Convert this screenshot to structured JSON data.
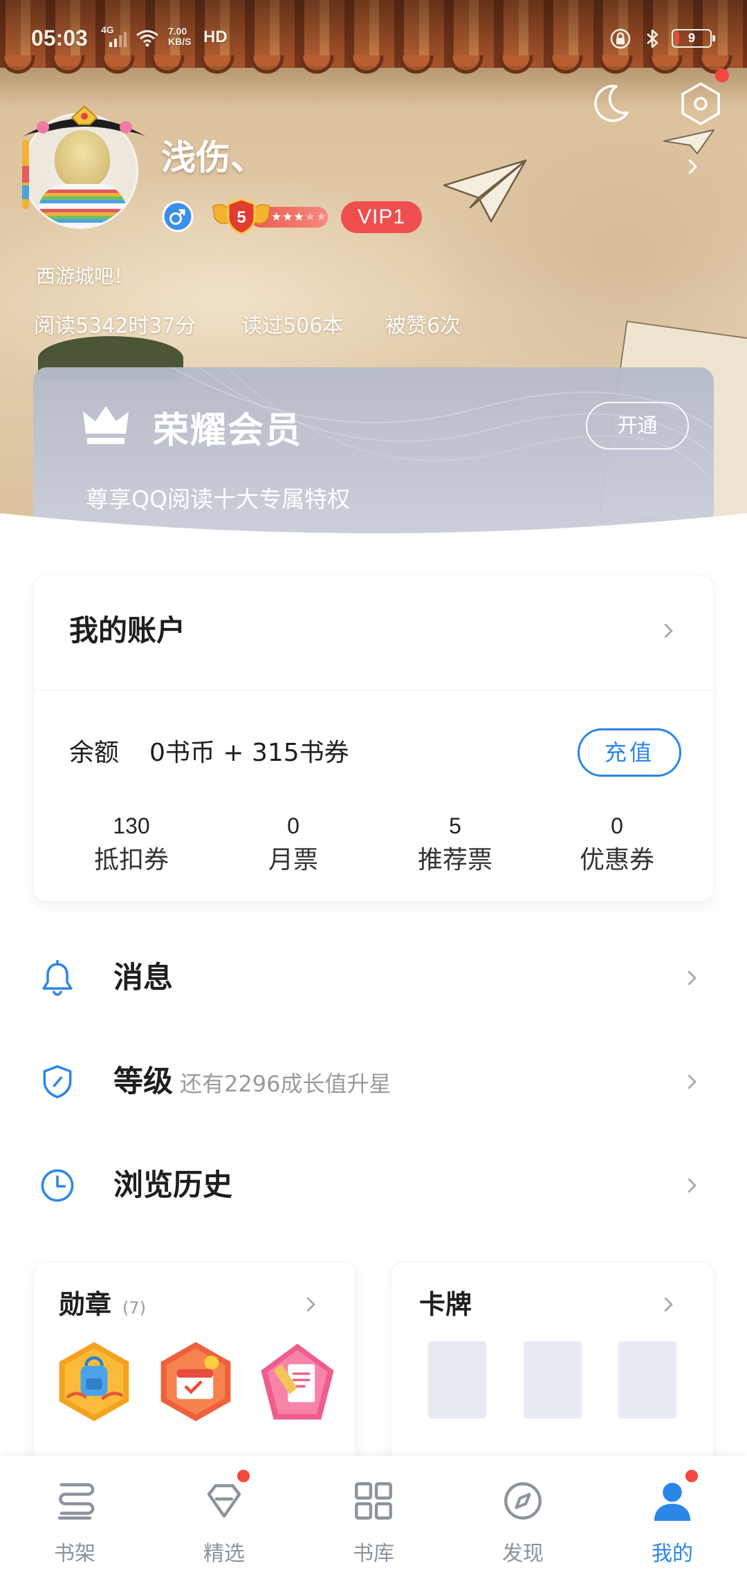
{
  "status_bar": {
    "time": "05:03",
    "network": "4G",
    "speed_value": "7.00",
    "speed_unit": "KB/S",
    "hd": "HD",
    "battery": "9",
    "icons": [
      "signal-icon",
      "wifi-icon",
      "rotation-lock-icon",
      "bluetooth-icon",
      "battery-icon"
    ]
  },
  "header_actions": {
    "icons": [
      "moon-icon",
      "settings-hexagon-icon"
    ],
    "settings_has_badge": true
  },
  "profile": {
    "username": "浅伤、",
    "gender_icon": "male-icon",
    "level": "5",
    "level_stars": 3,
    "level_stars_total": 5,
    "vip": "VIP1",
    "signature": "西游城吧！",
    "stats": {
      "reading_time": "阅读5342时37分",
      "books_read": "读过506本",
      "likes": "被赞6次"
    }
  },
  "honor": {
    "icon": "crown-icon",
    "title": "荣耀会员",
    "subtitle": "尊享QQ阅读十大专属特权",
    "button": "开通"
  },
  "account": {
    "title": "我的账户",
    "balance_label": "余额",
    "balance_value": "0书币 + 315书券",
    "recharge_button": "充值",
    "stats": [
      {
        "value": "130",
        "label": "抵扣券"
      },
      {
        "value": "0",
        "label": "月票"
      },
      {
        "value": "5",
        "label": "推荐票"
      },
      {
        "value": "0",
        "label": "优惠券"
      }
    ]
  },
  "menu": [
    {
      "icon": "bell-icon",
      "label": "消息",
      "hint": ""
    },
    {
      "icon": "shield-icon",
      "label": "等级",
      "hint": "还有2296成长值升星"
    },
    {
      "icon": "clock-icon",
      "label": "浏览历史",
      "hint": ""
    }
  ],
  "medals": {
    "title": "勋章",
    "count": "(7)",
    "items": [
      "medal-backpack-icon",
      "medal-calendar-icon",
      "medal-document-icon"
    ]
  },
  "cards": {
    "title": "卡牌"
  },
  "nav": {
    "items": [
      {
        "label": "书架",
        "icon": "bookshelf-icon",
        "active": false,
        "badge": false
      },
      {
        "label": "精选",
        "icon": "gem-icon",
        "active": false,
        "badge": true
      },
      {
        "label": "书库",
        "icon": "grid-icon",
        "active": false,
        "badge": false
      },
      {
        "label": "发现",
        "icon": "compass-icon",
        "active": false,
        "badge": false
      },
      {
        "label": "我的",
        "icon": "profile-icon",
        "active": true,
        "badge": true
      }
    ]
  },
  "colors": {
    "accent": "#2b86e6",
    "badge_red": "#f2473f",
    "vip_red": "#ef4e4e",
    "text": "#1f1f1f",
    "muted": "#9a9a9a",
    "nav_inactive": "#8c939b"
  }
}
